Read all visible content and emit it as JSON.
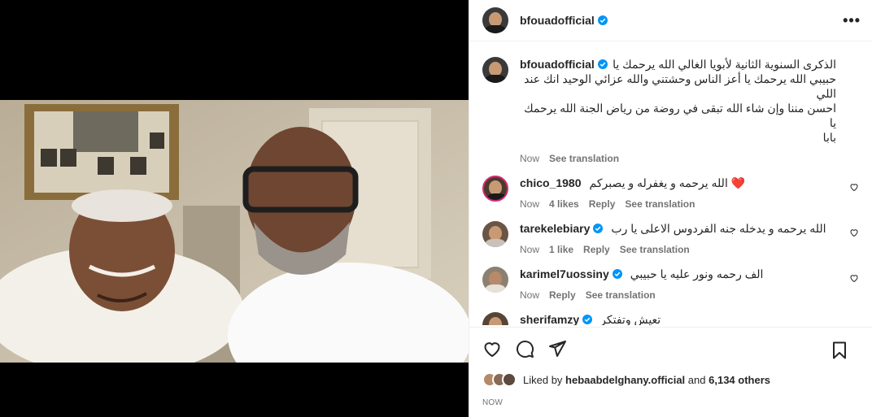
{
  "post": {
    "author": "bfouadofficial",
    "more_icon": "•••"
  },
  "caption": {
    "username": "bfouadofficial",
    "text_lines": [
      "الذكرى السنوية الثانية لأبويا الغالي الله يرحمك يا",
      "حبيبي الله يرحمك يا أعز الناس وحشتني والله عزائي الوحيد انك عند اللي",
      "احسن مننا وإن شاء الله تبقى في روضة من رياض الجنة الله يرحمك يا",
      "بابا"
    ],
    "time": "Now",
    "translate": "See translation"
  },
  "comments": [
    {
      "username": "chico_1980",
      "text": "الله يرحمه و يغفرله و يصبركم",
      "emoji": "❤️",
      "time": "Now",
      "likes": "4 likes",
      "reply": "Reply",
      "translate": "See translation"
    },
    {
      "username": "tarekelebiary",
      "text": "الله يرحمه و يدخله جنه الفردوس الاعلى يا رب",
      "time": "Now",
      "likes": "1 like",
      "reply": "Reply",
      "translate": "See translation"
    },
    {
      "username": "karimel7uossiny",
      "text": "الف رحمه ونور عليه يا حبيبي",
      "time": "Now",
      "reply": "Reply",
      "translate": "See translation"
    },
    {
      "username": "sherifamzy",
      "text": "تعيش وتفتكر",
      "time": "",
      "reply": "",
      "translate": ""
    }
  ],
  "likes": {
    "prefix": "Liked by",
    "user": "hebaabdelghany.official",
    "and": "and",
    "count": "6,134 others"
  },
  "date": "NOW",
  "colors": {
    "verified": "#0095f6",
    "heart": "#ed4956",
    "muted": "#737373"
  }
}
